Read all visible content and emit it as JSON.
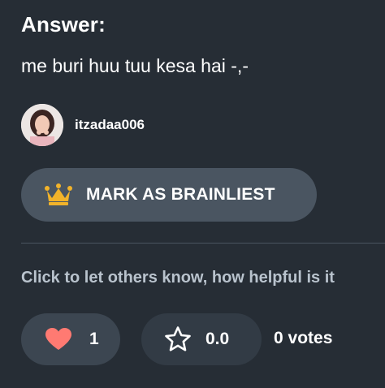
{
  "answer": {
    "heading": "Answer:",
    "text": "me buri huu tuu kesa hai -,-"
  },
  "author": {
    "username": "itzadaa006",
    "avatar_icon": "user-avatar-photo"
  },
  "brainliest": {
    "icon": "crown-icon",
    "label": "MARK AS BRAINLIEST",
    "accent": "#f2b32a"
  },
  "feedback": {
    "prompt": "Click to let others know, how helpful is it",
    "likes": {
      "icon": "heart-icon",
      "count": "1",
      "color": "#ff7a72"
    },
    "rating": {
      "icon": "star-outline-icon",
      "value": "0.0"
    },
    "votes": "0 votes"
  },
  "colors": {
    "background": "#262d35",
    "button": "#4a5561",
    "muted_text": "#b9c3cd"
  }
}
